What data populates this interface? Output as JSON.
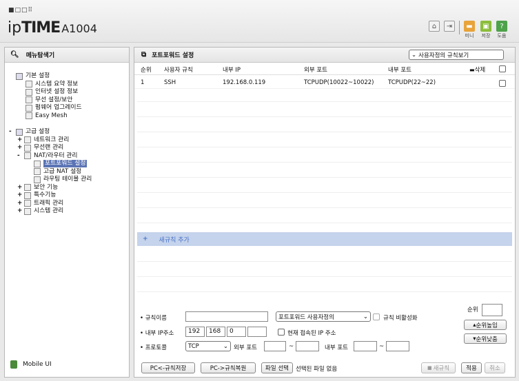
{
  "header": {
    "brand_dots": "■□□⠿",
    "brand": "ipTIME",
    "brand_ip": "ip",
    "brand_time": "TIME",
    "model": "A1004",
    "tools": [
      {
        "icon": "home-icon",
        "label": ""
      },
      {
        "icon": "logout-icon",
        "label": ""
      },
      {
        "icon": "minimize-icon",
        "label": "미니"
      },
      {
        "icon": "save-icon",
        "label": "저장"
      },
      {
        "icon": "help-icon",
        "label": "도움"
      }
    ]
  },
  "sidebar": {
    "title": "메뉴탐색기",
    "basic": {
      "label": "기본 설정",
      "items": [
        "시스템 요약 정보",
        "인터넷 설정 정보",
        "무선 설정/보안",
        "펌웨어 업그레이드",
        "Easy Mesh"
      ]
    },
    "advanced": {
      "label": "고급 설정",
      "items": [
        {
          "pm": "+",
          "label": "네트워크 관리"
        },
        {
          "pm": "+",
          "label": "무선랜 관리"
        },
        {
          "pm": "-",
          "label": "NAT/라우터 관리"
        }
      ],
      "nat_items": [
        "포트포워드 설정",
        "고급 NAT 설정",
        "라우팅 테이블 관리"
      ],
      "more": [
        {
          "pm": "+",
          "label": "보안 기능"
        },
        {
          "pm": "+",
          "label": "특수기능"
        },
        {
          "pm": "+",
          "label": "트래픽 관리"
        },
        {
          "pm": "+",
          "label": "시스템 관리"
        }
      ]
    },
    "mobile": "Mobile UI"
  },
  "main": {
    "title": "포트포워드 설정",
    "view_select": "사용자정의 규칙보기",
    "columns": [
      "순위",
      "사용자 규칙",
      "내부 IP",
      "외부 포트",
      "내부 포트",
      "삭제"
    ],
    "rows": [
      {
        "rank": "1",
        "name": "SSH",
        "ip": "192.168.0.119",
        "ext": "TCPUDP(10022~10022)",
        "int": "TCPUDP(22~22)"
      }
    ],
    "add_rule": {
      "plus": "+",
      "label": "새규칙 추가"
    },
    "form": {
      "rule_name_label": "규칙이름",
      "rule_name_value": "",
      "preset_select": "포트포워드 사용자정의",
      "disable_label": "규칙 비활성화",
      "rank_label": "순위",
      "rank_value": "",
      "ip_label": "내부 IP주소",
      "ip": [
        "192",
        "168",
        "0",
        ""
      ],
      "current_ip_label": "현재 접속된 IP 주소",
      "rank_up": "순위높임",
      "protocol_label": "프로토콜",
      "protocol_value": "TCP",
      "ext_port_label": "외부 포트",
      "int_port_label": "내부 포트",
      "tilde": "~",
      "rank_down": "순위낮춤"
    },
    "buttons": {
      "pc_save": "PC<-규칙저장",
      "pc_restore": "PC->규칙복원",
      "file_select": "파일 선택",
      "no_file": "선택된 파일 없음",
      "new_rule": "새규칙",
      "apply": "적용",
      "cancel": "취소"
    }
  }
}
